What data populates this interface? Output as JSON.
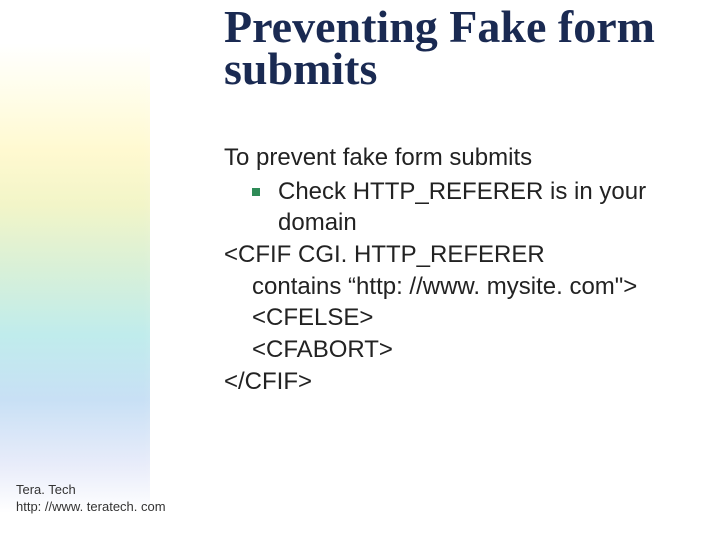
{
  "title": "Preventing Fake form submits",
  "intro": "To prevent fake form submits",
  "bullet": {
    "text": "Check HTTP_REFERER is in your domain"
  },
  "code": {
    "line1": "<CFIF CGI. HTTP_REFERER",
    "line2": "contains “http: //www. mysite. com\">",
    "line3": "<CFELSE>",
    "line4": "<CFABORT>",
    "line5": "</CFIF>"
  },
  "footer": {
    "line1": "Tera. Tech",
    "line2": "http: //www. teratech. com"
  }
}
